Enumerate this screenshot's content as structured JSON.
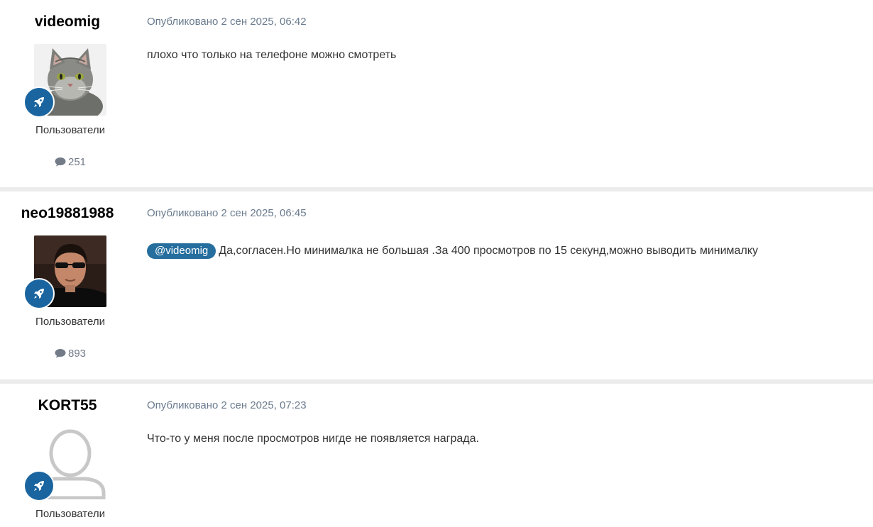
{
  "posts": [
    {
      "author": "videomig",
      "avatar": "cat-photo",
      "group": "Пользователи",
      "post_count": "251",
      "published": "Опубликовано 2 сен 2025, 06:42",
      "mention": "",
      "text": "плохо что только на телефоне можно смотреть"
    },
    {
      "author": "neo19881988",
      "avatar": "man-sunglasses-photo",
      "group": "Пользователи",
      "post_count": "893",
      "published": "Опубликовано 2 сен 2025, 06:45",
      "mention": "@videomig",
      "text": "Да,согласен.Но минималка не большая .За 400 просмотров по 15 секунд,можно выводить минималку"
    },
    {
      "author": "KORT55",
      "avatar": "default-user-silhouette",
      "group": "Пользователи",
      "post_count": "",
      "published": "Опубликовано 2 сен 2025, 07:23",
      "mention": "",
      "text": "Что-то у меня после просмотров нигде не появляется награда."
    }
  ],
  "icons": {
    "rank_badge": "rocket-icon",
    "post_count": "comment-bubble-icon"
  },
  "colors": {
    "badge": "#1a65a0",
    "mention_bg": "#256e9e",
    "meta_text": "#6a7b8e",
    "page_bg": "#ebebeb"
  }
}
